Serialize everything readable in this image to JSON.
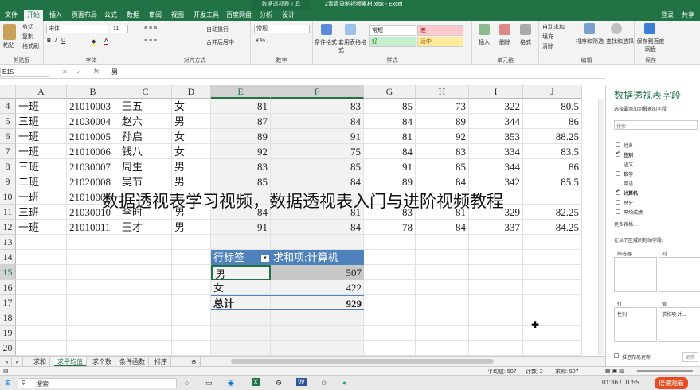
{
  "window": {
    "context_tab": "数据透视表工具",
    "title": "2青青录制视频素材.xlsx - Excel"
  },
  "tabs": [
    "文件",
    "开始",
    "插入",
    "页面布局",
    "公式",
    "数据",
    "审阅",
    "视图",
    "开发工具",
    "百度网盘",
    "分析",
    "设计"
  ],
  "account": {
    "login": "登录",
    "share": "共享"
  },
  "ribbon": {
    "clipboard": {
      "paste": "粘贴",
      "cut": "剪切",
      "copy": "复制",
      "format_painter": "格式刷",
      "label": "剪贴板"
    },
    "font": {
      "name": "宋体",
      "size": "11",
      "label": "字体"
    },
    "alignment": {
      "wrap": "自动换行",
      "merge": "合并后居中",
      "label": "对齐方式"
    },
    "number": {
      "format": "常规",
      "label": "数字"
    },
    "styles": {
      "conditional": "条件格式",
      "table": "套用表格格式",
      "normal": "常规",
      "bad": "差",
      "good": "好",
      "neutral": "适中",
      "label": "样式"
    },
    "cells": {
      "insert": "插入",
      "delete": "删除",
      "format": "格式",
      "label": "单元格"
    },
    "editing": {
      "autosum": "自动求和",
      "fill": "填充",
      "clear": "清除",
      "sort": "排序和筛选",
      "find": "查找和选择",
      "label": "编辑"
    },
    "save": {
      "btn": "保存到百度网盘",
      "label": "保存"
    }
  },
  "formula_bar": {
    "name_box": "E15",
    "fx": "fx",
    "content": "男"
  },
  "columns": [
    "A",
    "B",
    "C",
    "D",
    "E",
    "F",
    "G",
    "H",
    "I",
    "J"
  ],
  "rows": [
    {
      "n": "4",
      "cls": "一班",
      "id": "21010003",
      "name": "王五",
      "sex": "女",
      "e": "81",
      "f": "83",
      "g": "85",
      "h": "73",
      "i": "322",
      "j": "80.5"
    },
    {
      "n": "5",
      "cls": "三班",
      "id": "21030004",
      "name": "赵六",
      "sex": "男",
      "e": "87",
      "f": "84",
      "g": "84",
      "h": "89",
      "i": "344",
      "j": "86"
    },
    {
      "n": "6",
      "cls": "一班",
      "id": "21010005",
      "name": "孙启",
      "sex": "女",
      "e": "89",
      "f": "91",
      "g": "81",
      "h": "92",
      "i": "353",
      "j": "88.25"
    },
    {
      "n": "7",
      "cls": "一班",
      "id": "21010006",
      "name": "钱八",
      "sex": "女",
      "e": "92",
      "f": "75",
      "g": "84",
      "h": "83",
      "i": "334",
      "j": "83.5"
    },
    {
      "n": "8",
      "cls": "三班",
      "id": "21030007",
      "name": "周生",
      "sex": "男",
      "e": "83",
      "f": "85",
      "g": "91",
      "h": "85",
      "i": "344",
      "j": "86"
    },
    {
      "n": "9",
      "cls": "二班",
      "id": "21020008",
      "name": "吴节",
      "sex": "男",
      "e": "85",
      "f": "84",
      "g": "89",
      "h": "84",
      "i": "342",
      "j": "85.5"
    },
    {
      "n": "10",
      "cls": "一班",
      "id": "21010009",
      "name": "",
      "sex": "",
      "e": "",
      "f": "",
      "g": "",
      "h": "",
      "i": "",
      "j": ""
    },
    {
      "n": "11",
      "cls": "三班",
      "id": "21030010",
      "name": "李时",
      "sex": "男",
      "e": "84",
      "f": "81",
      "g": "83",
      "h": "81",
      "i": "329",
      "j": "82.25"
    },
    {
      "n": "12",
      "cls": "一班",
      "id": "21010011",
      "name": "王才",
      "sex": "男",
      "e": "91",
      "f": "84",
      "g": "78",
      "h": "84",
      "i": "337",
      "j": "84.25"
    },
    {
      "n": "13"
    },
    {
      "n": "14"
    },
    {
      "n": "15"
    },
    {
      "n": "16"
    },
    {
      "n": "17"
    },
    {
      "n": "18"
    },
    {
      "n": "19"
    },
    {
      "n": "20"
    }
  ],
  "pivot": {
    "row_header": "行标签",
    "value_header": "求和项:计算机",
    "rows": [
      {
        "label": "男",
        "value": "507"
      },
      {
        "label": "女",
        "value": "422"
      }
    ],
    "total_label": "总计",
    "total_value": "929"
  },
  "overlay_text": "数据透视表学习视频，数据透视表入门与进阶视频教程",
  "sheet_tabs": [
    "求和",
    "求平均值",
    "求个数",
    "条件函数",
    "排序"
  ],
  "status": {
    "average": "平均值: 507",
    "count": "计数: 2",
    "sum": "求和: 507"
  },
  "pane": {
    "title": "数据透视表字段",
    "subtitle": "选择要添加到报表的字段:",
    "search_placeholder": "搜索",
    "fields": [
      {
        "label": "姓名",
        "checked": false
      },
      {
        "label": "性别",
        "checked": true
      },
      {
        "label": "语文",
        "checked": false
      },
      {
        "label": "数学",
        "checked": false
      },
      {
        "label": "英语",
        "checked": false
      },
      {
        "label": "计算机",
        "checked": true
      },
      {
        "label": "总分",
        "checked": false
      },
      {
        "label": "平均成绩",
        "checked": false
      }
    ],
    "more_tables": "更多表格...",
    "drag_hint": "在以下区域间拖动字段:",
    "filters": "筛选器",
    "columns": "列",
    "rows": "行",
    "values": "值",
    "rows_value": "性别",
    "values_value": "求和项:计...",
    "defer": "推迟布局更新",
    "update": "更新"
  },
  "taskbar": {
    "search": "搜索",
    "time": "01:36 / 01:55",
    "record": "倍速观看"
  }
}
